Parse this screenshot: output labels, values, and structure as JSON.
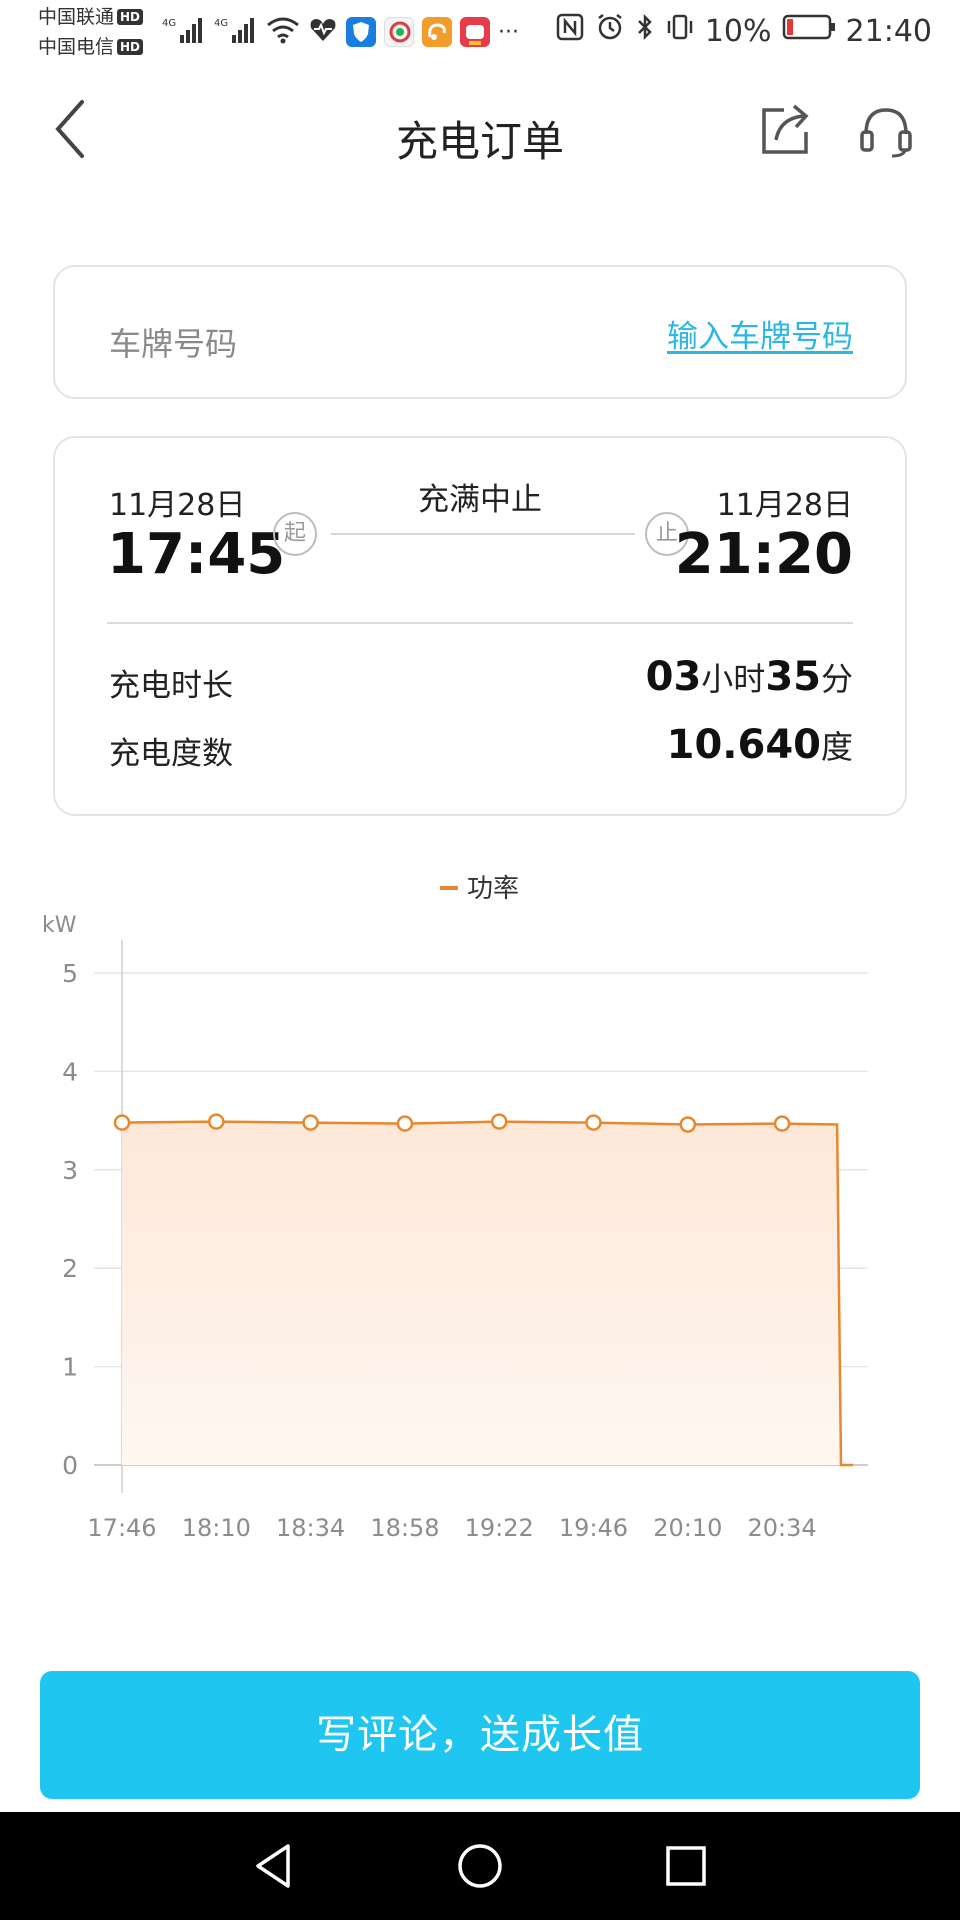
{
  "status_bar": {
    "carrier_1": "中国联通",
    "carrier_2": "中国电信",
    "hd_badge": "HD",
    "network_1": "4G",
    "network_2": "4G",
    "more": "···",
    "battery": "10%",
    "time": "21:40",
    "icons": [
      "signal-icon",
      "wifi-icon",
      "health-icon",
      "shield-app-icon",
      "video-app-icon",
      "uc-browser-icon",
      "game-app-icon",
      "nfc-icon",
      "alarm-icon",
      "bluetooth-icon",
      "vibrate-icon",
      "battery-icon"
    ]
  },
  "nav": {
    "title": "充电订单",
    "icons": [
      "back-arrow-icon",
      "share-icon",
      "headset-icon"
    ]
  },
  "plate": {
    "label": "车牌号码",
    "link": "输入车牌号码"
  },
  "order": {
    "start_date": "11月28日",
    "start_time": "17:45",
    "start_tag": "起",
    "end_date": "11月28日",
    "end_time": "21:20",
    "end_tag": "止",
    "stop_reason": "充满中止",
    "duration_label": "充电时长",
    "duration_hours": "03",
    "duration_hours_unit": "小时",
    "duration_minutes": "35",
    "duration_minutes_unit": "分",
    "energy_label": "充电度数",
    "energy_value": "10.640",
    "energy_unit": "度"
  },
  "chart_data": {
    "type": "area",
    "ylabel": "kW",
    "ylim": [
      0,
      5
    ],
    "yticks": [
      0,
      1,
      2,
      3,
      4,
      5
    ],
    "xticks": [
      "17:46",
      "18:10",
      "18:34",
      "18:58",
      "19:22",
      "19:46",
      "20:10",
      "20:34"
    ],
    "legend_position": "top-center",
    "grid": true,
    "series": [
      {
        "name": "功率",
        "color": "#e8882e",
        "fill": "#fde8d8",
        "x_minutes": [
          0,
          24,
          48,
          72,
          96,
          120,
          144,
          168,
          182,
          183
        ],
        "values": [
          3.48,
          3.49,
          3.48,
          3.47,
          3.49,
          3.48,
          3.46,
          3.47,
          3.46,
          0.0
        ],
        "marker_indices": [
          0,
          1,
          2,
          3,
          4,
          5,
          6,
          7
        ]
      }
    ]
  },
  "cta": {
    "label": "写评论，送成长值"
  },
  "android_nav": {
    "icons": [
      "nav-back-icon",
      "nav-home-icon",
      "nav-recent-icon"
    ]
  }
}
